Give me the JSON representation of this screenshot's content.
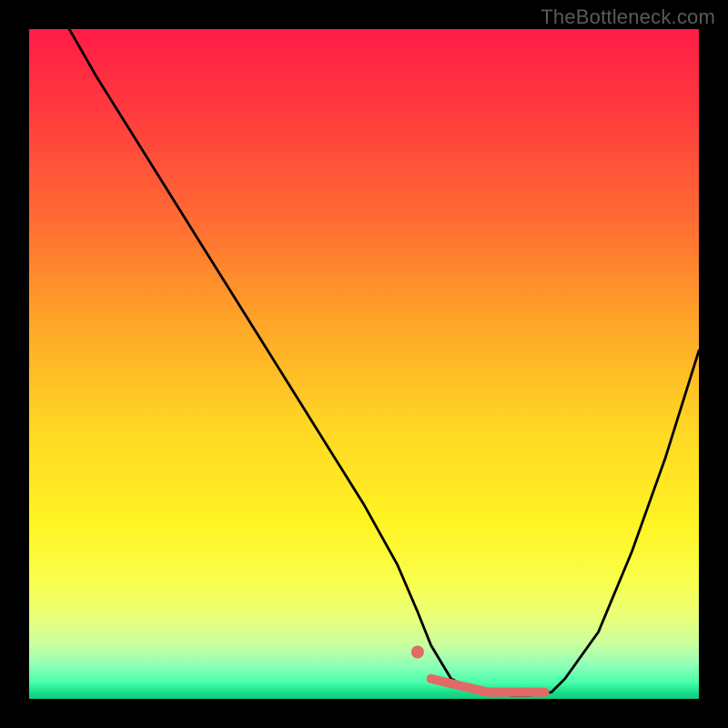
{
  "watermark": "TheBottleneck.com",
  "colors": {
    "frame": "#000000",
    "curve": "#000000",
    "marker": "#e26a64",
    "marker_outline": "#e26a64"
  },
  "chart_data": {
    "type": "line",
    "title": "",
    "xlabel": "",
    "ylabel": "",
    "xlim": [
      0,
      100
    ],
    "ylim": [
      0,
      100
    ],
    "grid": false,
    "legend": false,
    "x": [
      6,
      10,
      15,
      20,
      25,
      30,
      35,
      40,
      45,
      50,
      55,
      58,
      60,
      63,
      67,
      72,
      75,
      78,
      80,
      85,
      90,
      95,
      100
    ],
    "values": [
      100,
      93,
      85,
      77,
      69,
      61,
      53,
      45,
      37,
      29,
      20,
      13,
      8,
      3,
      1,
      0.5,
      0.5,
      1,
      3,
      10,
      22,
      36,
      52
    ],
    "markers": {
      "dot": {
        "x": 58,
        "y": 7
      },
      "segment": {
        "x0": 60,
        "y0": 3,
        "x1": 77,
        "y1": 1
      }
    }
  }
}
